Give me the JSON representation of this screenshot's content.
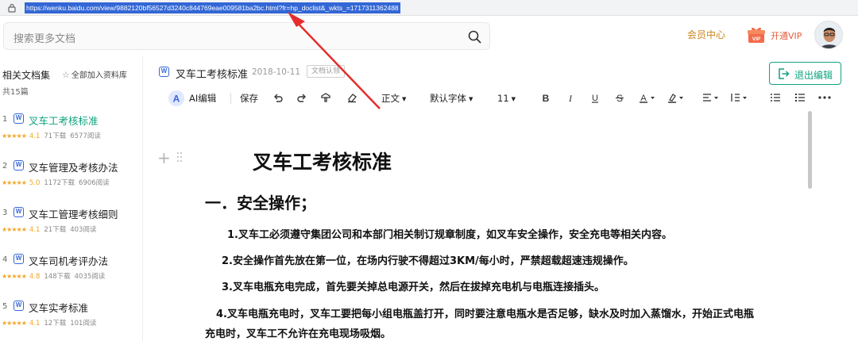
{
  "browser": {
    "url": "https://wenku.baidu.com/view/9882120bf56527d3240c844769eae009581ba2bc.html?fr=hp_doclist&_wkts_=1717311362488"
  },
  "header": {
    "search_placeholder": "搜索更多文档",
    "vip_center": "会员中心",
    "open_vip": "开通VIP"
  },
  "sidebar": {
    "title": "相关文档集",
    "add_all": "全部加入资料库",
    "count": "共15篇",
    "items": [
      {
        "num": "1",
        "name": "叉车工考核标准",
        "stars": "★★★★★",
        "rating": "4.1",
        "downloads": "71下载",
        "reads": "6577阅读"
      },
      {
        "num": "2",
        "name": "叉车管理及考核办法",
        "stars": "★★★★★",
        "rating": "5.0",
        "downloads": "1172下载",
        "reads": "6906阅读"
      },
      {
        "num": "3",
        "name": "叉车工管理考核细则",
        "stars": "★★★★★",
        "rating": "4.1",
        "downloads": "21下载",
        "reads": "403阅读"
      },
      {
        "num": "4",
        "name": "叉车司机考评办法",
        "stars": "★★★★★",
        "rating": "4.8",
        "downloads": "148下载",
        "reads": "4035阅读"
      },
      {
        "num": "5",
        "name": "叉车实考标准",
        "stars": "★★★★★",
        "rating": "4.1",
        "downloads": "12下载",
        "reads": "101阅读"
      }
    ]
  },
  "doc": {
    "title": "叉车工考核标准",
    "date": "2018-10-11",
    "tag": "文档认领",
    "exit_edit": "退出编辑"
  },
  "toolbar": {
    "ai_edit": "AI编辑",
    "save": "保存",
    "style": "正文",
    "font": "默认字体",
    "size": "11"
  },
  "content": {
    "heading": "叉车工考核标准",
    "section": "一．安全操作；",
    "p1": "1.叉车工必须遵守集团公司和本部门相关制订规章制度，如叉车安全操作，安全充电等相关内容。",
    "p2": "2.安全操作首先放在第一位，在场内行驶不得超过3KM/每小时，严禁超载超速违规操作。",
    "p3": "3.叉车电瓶充电完成，首先要关掉总电源开关，然后在拔掉充电机与电瓶连接插头。",
    "p4a": "4.叉车电瓶充电时，叉车工要把每小组电瓶盖打开，同时要注意电瓶水是否足够，缺水及时加入蒸馏水，开始正式电瓶",
    "p4b": "充电时，叉车工不允许在充电现场吸烟。"
  },
  "colors": {
    "accent_green": "#10a37f",
    "url_highlight": "#3367d6",
    "annotation_red": "#e52d2d",
    "vip_gold": "#c9851b",
    "word_blue": "#3667d8",
    "star_orange": "#f1a72a"
  }
}
